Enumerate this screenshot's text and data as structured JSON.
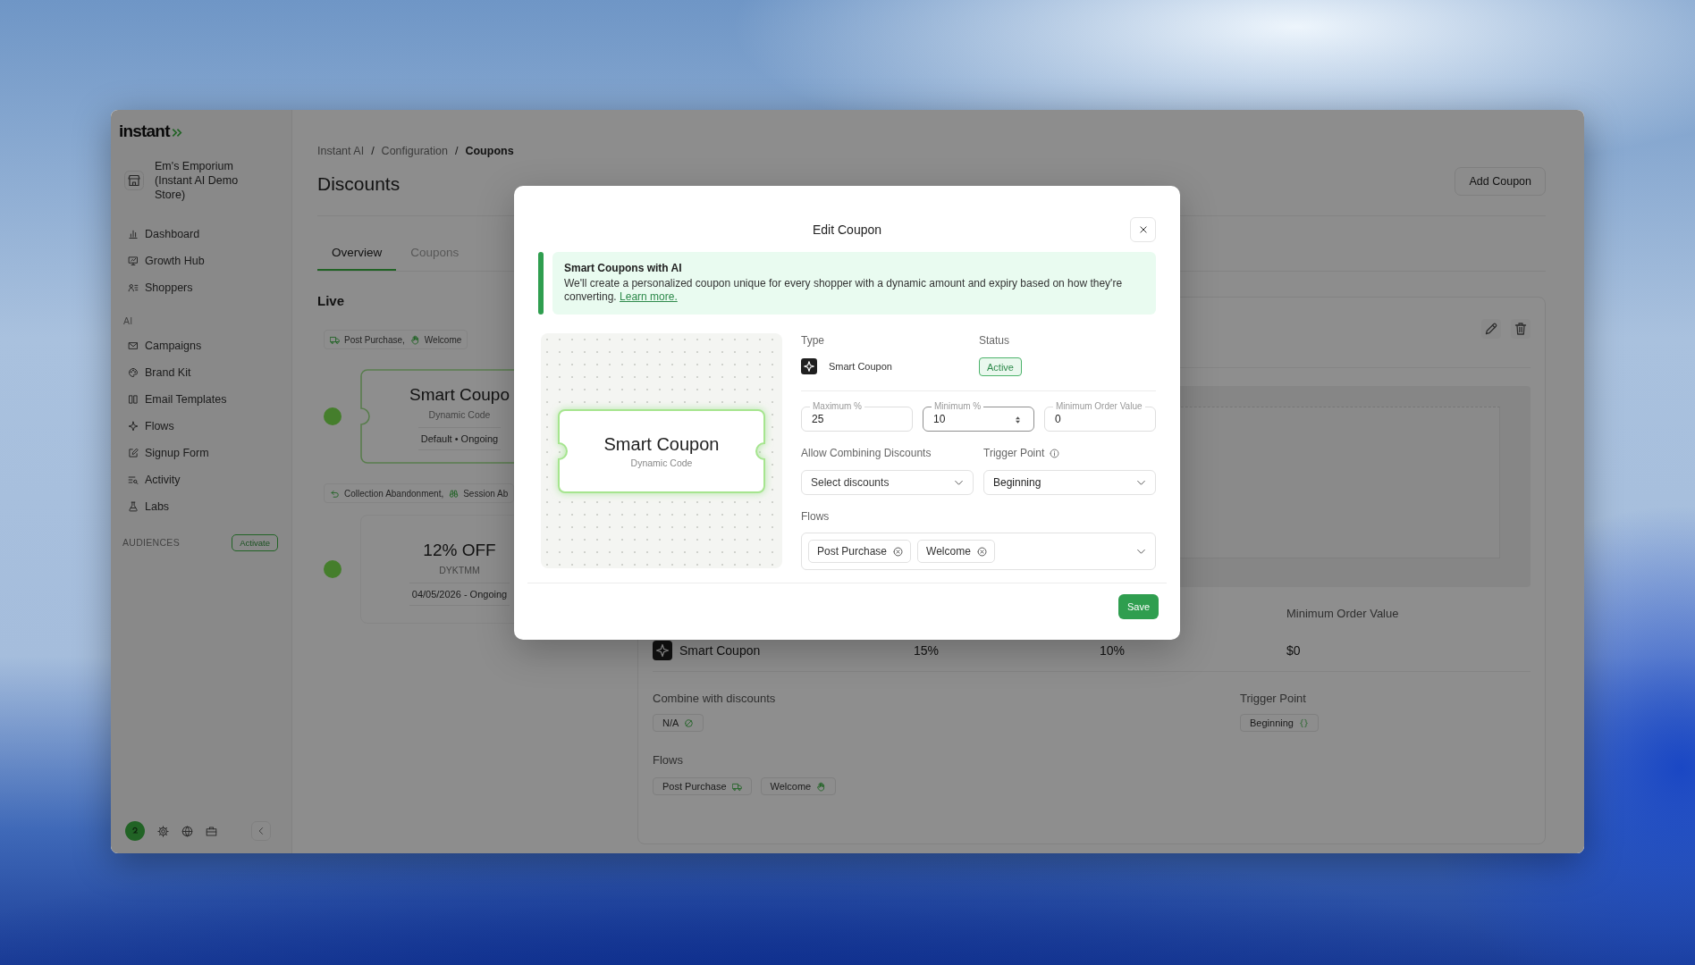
{
  "sidebar": {
    "logo": "instant",
    "store_name": "Em's Emporium (Instant AI Demo Store)",
    "nav_groups": [
      {
        "items": [
          {
            "label": "Dashboard",
            "selected": false
          },
          {
            "label": "Growth Hub",
            "selected": false
          },
          {
            "label": "Shoppers",
            "selected": false
          }
        ]
      },
      {
        "heading": "AI",
        "items": [
          {
            "label": "Campaigns",
            "selected": false
          },
          {
            "label": "Brand Kit",
            "selected": false
          },
          {
            "label": "Email Templates",
            "selected": false
          },
          {
            "label": "Flows",
            "selected": false
          },
          {
            "label": "Signup Form",
            "selected": false
          },
          {
            "label": "Activity",
            "selected": false
          },
          {
            "label": "Labs",
            "selected": false
          }
        ]
      }
    ],
    "audiences": {
      "heading": "AUDIENCES",
      "action": "Activate"
    }
  },
  "breadcrumb": {
    "items": [
      "Instant AI",
      "Configuration",
      "Coupons"
    ],
    "separators": [
      "/",
      "/"
    ]
  },
  "page": {
    "title": "Discounts",
    "add_button": "Add Coupon"
  },
  "tabs": [
    {
      "label": "Overview",
      "selected": true
    },
    {
      "label": "Coupons",
      "selected": false
    }
  ],
  "live": {
    "heading": "Live",
    "coupons": [
      {
        "flows": [
          "Post Purchase,",
          "Welcome"
        ],
        "title": "Smart Coupo",
        "code": "Dynamic Code",
        "period": "Default • Ongoing",
        "selected": true
      },
      {
        "flows": [
          "Collection Abandonment,",
          "Session Ab"
        ],
        "title": "12% OFF",
        "code": "DYKTMM",
        "period": "04/05/2026 - Ongoing",
        "selected": false
      }
    ]
  },
  "detail": {
    "summary": {
      "type": "Smart Coupon",
      "maximum": "15%",
      "minimum": "10%",
      "min_order_label": "Minimum Order Value",
      "min_order": "$0"
    },
    "combine": {
      "label": "Combine with discounts",
      "value": "N/A"
    },
    "trigger": {
      "label": "Trigger Point",
      "value": "Beginning"
    },
    "flows": {
      "label": "Flows",
      "items": [
        "Post Purchase",
        "Welcome"
      ]
    }
  },
  "modal": {
    "title": "Edit Coupon",
    "banner": {
      "title": "Smart Coupons with AI",
      "text": "We'll create a personalized coupon unique for every shopper with a dynamic amount and expiry based on how they're converting.",
      "link": "Learn more."
    },
    "preview": {
      "title": "Smart Coupon",
      "subtitle": "Dynamic Code"
    },
    "type": {
      "label": "Type",
      "value": "Smart Coupon"
    },
    "status": {
      "label": "Status",
      "value": "Active"
    },
    "fields": [
      {
        "label": "Maximum %",
        "value": "25",
        "focused": false
      },
      {
        "label": "Minimum %",
        "value": "10",
        "focused": true
      },
      {
        "label": "Minimum Order Value",
        "value": "0",
        "focused": false
      }
    ],
    "selects": [
      {
        "label": "Allow Combining Discounts",
        "placeholder": "Select discounts"
      },
      {
        "label": "Trigger Point",
        "value": "Beginning"
      }
    ],
    "flows": {
      "label": "Flows",
      "chips": [
        "Post Purchase",
        "Welcome"
      ]
    },
    "save": "Save"
  }
}
